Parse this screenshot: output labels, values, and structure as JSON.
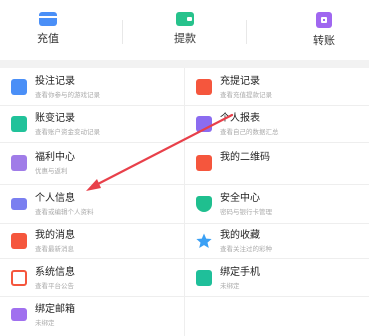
{
  "top_actions": [
    {
      "label": "充值",
      "icon": "recharge-card-icon",
      "color": "#4a8ff7"
    },
    {
      "label": "提款",
      "icon": "withdraw-wallet-icon",
      "color": "#27c28c"
    },
    {
      "label": "转账",
      "icon": "transfer-icon",
      "color": "#a067f0"
    }
  ],
  "menu": [
    {
      "title": "投注记录",
      "subtitle": "查看你参与的游戏记录",
      "icon": "bet-record-icon",
      "color": "#4a8ff7"
    },
    {
      "title": "充提记录",
      "subtitle": "查看充值提款记录",
      "icon": "calendar-record-icon",
      "color": "#f5563d"
    },
    {
      "title": "账变记录",
      "subtitle": "查看账户资金变动记录",
      "icon": "ledger-icon",
      "color": "#21c29a"
    },
    {
      "title": "个人报表",
      "subtitle": "查看自己的数据汇总",
      "icon": "report-icon",
      "color": "#8b6cf0"
    },
    {
      "title": "福利中心",
      "subtitle": "优惠与返利",
      "icon": "gift-grid-icon",
      "color": "#a07ce8"
    },
    {
      "title": "我的二维码",
      "subtitle": "",
      "icon": "qrcode-icon",
      "color": "#f5563d"
    },
    {
      "title": "个人信息",
      "subtitle": "查看或编辑个人资料",
      "icon": "id-card-icon",
      "color": "#7a7ff0"
    },
    {
      "title": "安全中心",
      "subtitle": "密码与银行卡管理",
      "icon": "shield-plus-icon",
      "color": "#1fbf8f"
    },
    {
      "title": "我的消息",
      "subtitle": "查看最新消息",
      "icon": "message-icon",
      "color": "#f5563d"
    },
    {
      "title": "我的收藏",
      "subtitle": "查看关注过的彩种",
      "icon": "star-icon",
      "color": "#3aa0f5"
    },
    {
      "title": "系统信息",
      "subtitle": "查看平台公告",
      "icon": "system-message-icon",
      "color": "#f5563d"
    },
    {
      "title": "绑定手机",
      "subtitle": "未绑定",
      "icon": "phone-icon",
      "color": "#1fbf9a"
    },
    {
      "title": "绑定邮箱",
      "subtitle": "未绑定",
      "icon": "mail-icon",
      "color": "#a070ef"
    }
  ]
}
